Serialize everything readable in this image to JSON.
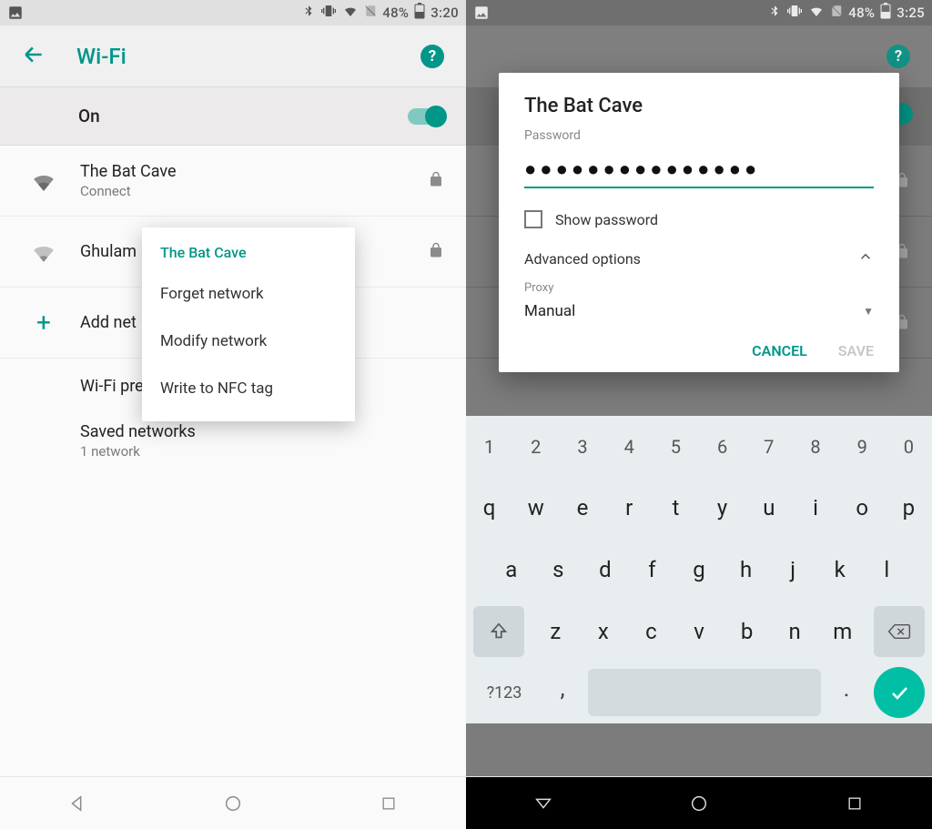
{
  "left": {
    "status": {
      "battery": "48%",
      "time": "3:20"
    },
    "title": "Wi-Fi",
    "on_label": "On",
    "networks": [
      {
        "name": "The Bat Cave",
        "sub": "Connect",
        "lock": true
      },
      {
        "name": "Ghulam",
        "sub": "",
        "lock": true
      }
    ],
    "add_label": "Add net",
    "prefs_label": "Wi-Fi preferences",
    "saved_label": "Saved networks",
    "saved_sub": "1 network",
    "ctx": {
      "title": "The Bat Cave",
      "items": [
        "Forget network",
        "Modify network",
        "Write to NFC tag"
      ]
    }
  },
  "right": {
    "status": {
      "battery": "48%",
      "time": "3:25"
    },
    "modal": {
      "title": "The Bat Cave",
      "password_label": "Password",
      "password_value": "●●●●●●●●●●●●●●●",
      "show_pw": "Show password",
      "advanced": "Advanced options",
      "proxy_label": "Proxy",
      "proxy_value": "Manual",
      "cancel": "CANCEL",
      "save": "SAVE"
    },
    "keyboard": {
      "nums": [
        "1",
        "2",
        "3",
        "4",
        "5",
        "6",
        "7",
        "8",
        "9",
        "0"
      ],
      "row1": [
        "q",
        "w",
        "e",
        "r",
        "t",
        "y",
        "u",
        "i",
        "o",
        "p"
      ],
      "row2": [
        "a",
        "s",
        "d",
        "f",
        "g",
        "h",
        "j",
        "k",
        "l"
      ],
      "row3": [
        "z",
        "x",
        "c",
        "v",
        "b",
        "n",
        "m"
      ],
      "sym": "?123",
      "comma": ",",
      "dot": "."
    }
  }
}
